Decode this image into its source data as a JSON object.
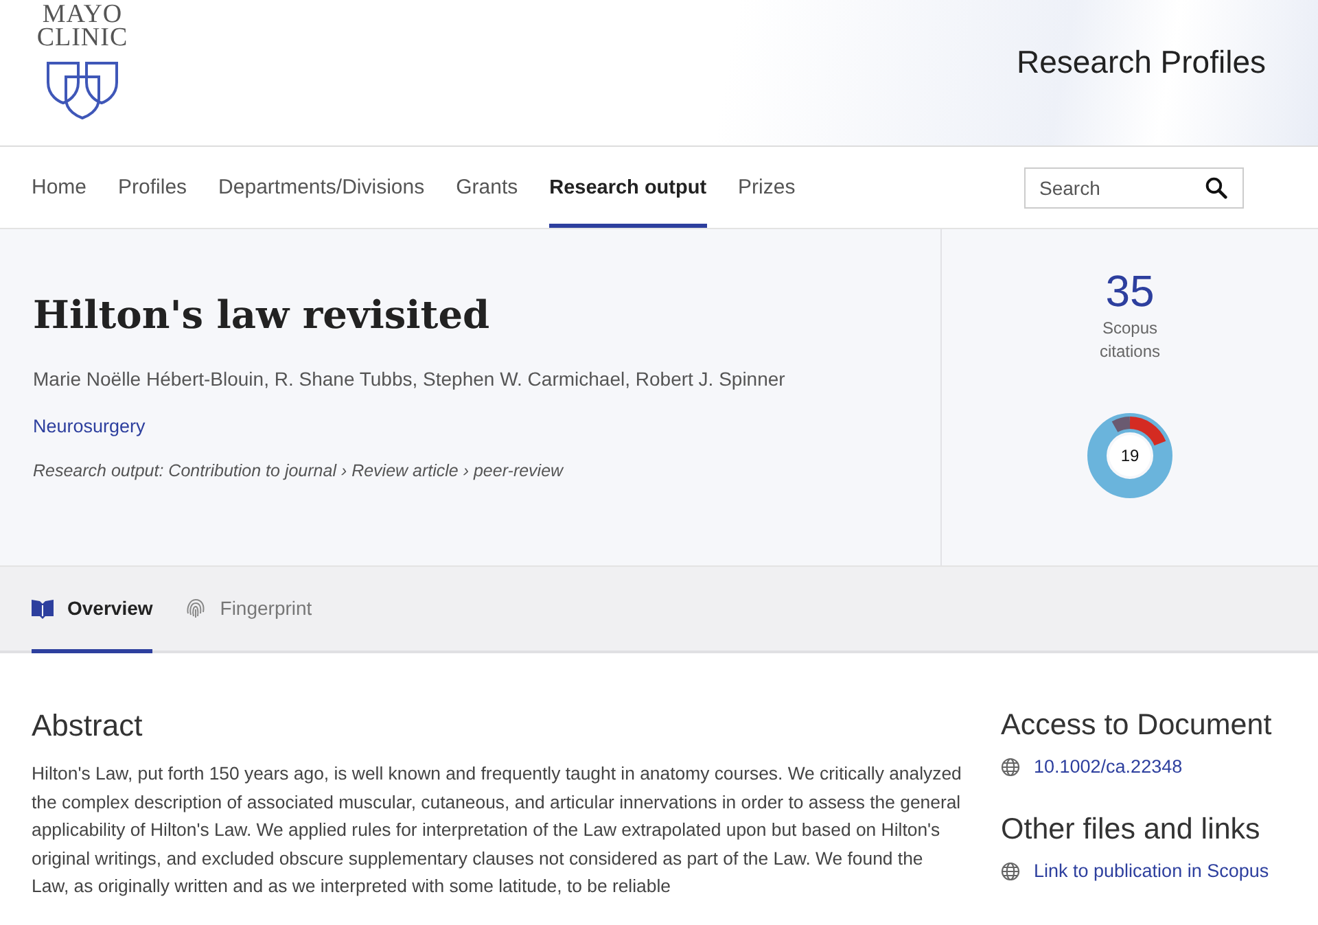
{
  "header": {
    "logo_text": [
      "MAYO",
      "CLINIC"
    ],
    "site_title": "Research Profiles"
  },
  "nav": {
    "items": [
      {
        "label": "Home",
        "selected": false
      },
      {
        "label": "Profiles",
        "selected": false
      },
      {
        "label": "Departments/Divisions",
        "selected": false
      },
      {
        "label": "Grants",
        "selected": false
      },
      {
        "label": "Research output",
        "selected": true
      },
      {
        "label": "Prizes",
        "selected": false
      }
    ],
    "search": {
      "placeholder": "Search"
    }
  },
  "publication": {
    "title": "Hilton's law revisited",
    "authors": "Marie Noëlle Hébert-Blouin, R. Shane Tubbs, Stephen W. Carmichael, Robert J. Spinner",
    "department": "Neurosurgery",
    "type": "Research output: Contribution to journal › Review article › peer-review"
  },
  "metrics": {
    "citations": "35",
    "citations_label": [
      "Scopus",
      "citations"
    ],
    "altmetric_score": "19"
  },
  "tabs": [
    {
      "label": "Overview",
      "kind": "book",
      "selected": true
    },
    {
      "label": "Fingerprint",
      "kind": "fingerprint",
      "selected": false
    }
  ],
  "abstract": {
    "heading": "Abstract",
    "text": "Hilton's Law, put forth 150 years ago, is well known and frequently taught in anatomy courses. We critically analyzed the complex description of associated muscular, cutaneous, and articular innervations in order to assess the general applicability of Hilton's Law. We applied rules for interpretation of the Law extrapolated upon but based on Hilton's original writings, and excluded obscure supplementary clauses not considered as part of the Law. We found the Law, as originally written and as we interpreted with some latitude, to be reliable"
  },
  "sidebar": [
    {
      "heading": "Access to Document",
      "link": "10.1002/ca.22348"
    },
    {
      "heading": "Other files and links",
      "link": "Link to publication in Scopus"
    }
  ]
}
